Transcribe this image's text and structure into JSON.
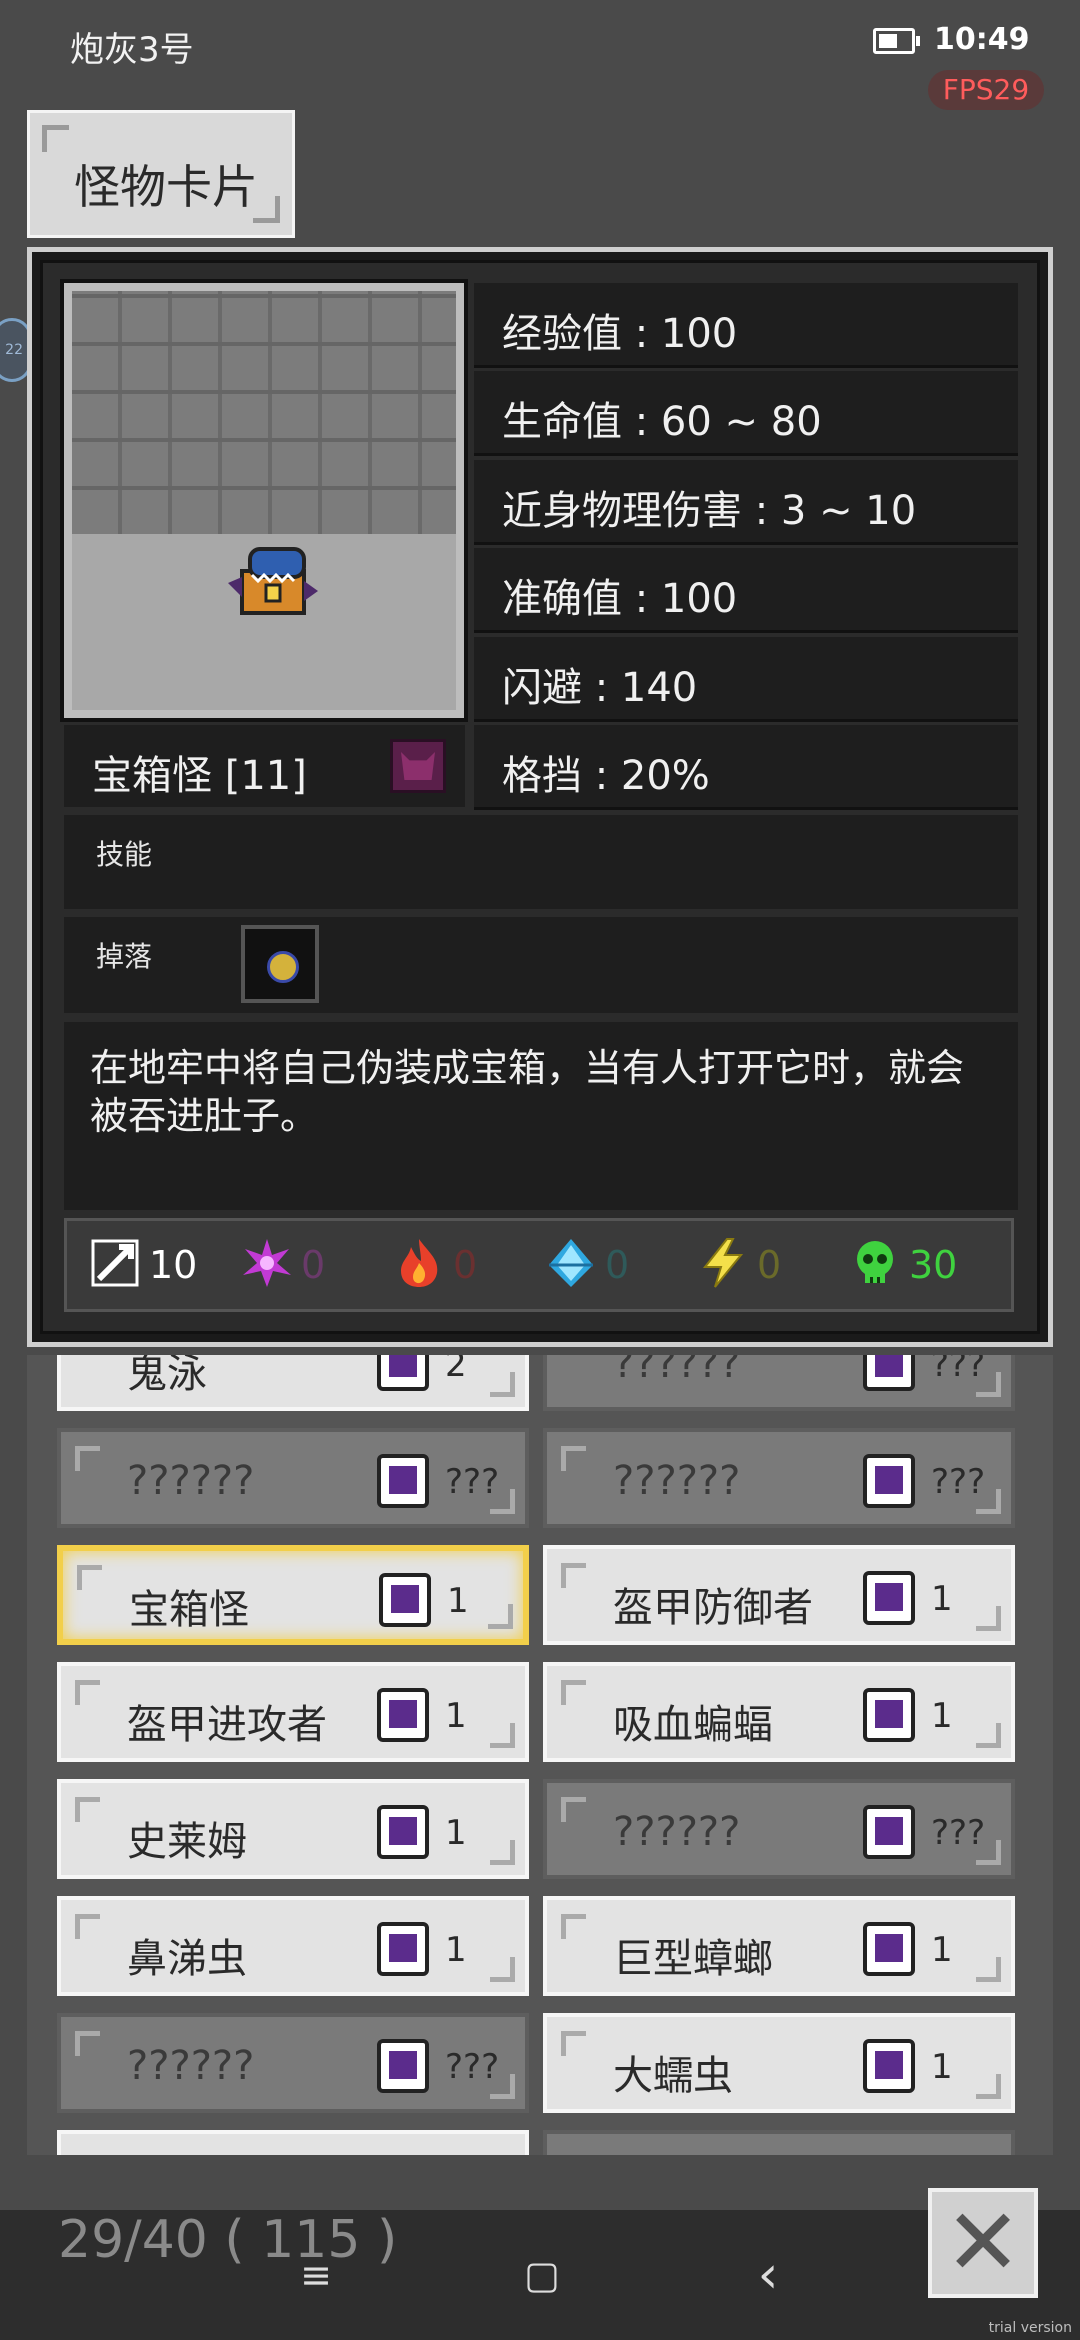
{
  "status_bar": {
    "title": "炮灰3号",
    "time": "10:49",
    "fps": "FPS29"
  },
  "tab": {
    "label": "怪物卡片"
  },
  "side_bubble": {
    "text": "22"
  },
  "monster": {
    "name": "宝箱怪 [11]",
    "stats": [
      "经验值 : 100",
      "生命值 : 60 ~ 80",
      "近身物理伤害 : 3 ~ 10",
      "准确值 : 100",
      "闪避 : 140",
      "格挡 : 20%"
    ],
    "skills_label": "技能",
    "drops_label": "掉落",
    "description": "在地牢中将自己伪装成宝箱，当有人打开它时，就会被吞进肚子。",
    "resistances": [
      {
        "icon": "sword-icon",
        "value": "10",
        "color": "#ffffff"
      },
      {
        "icon": "magic-burst-icon",
        "value": "0",
        "color": "#6a3a6a"
      },
      {
        "icon": "fire-icon",
        "value": "0",
        "color": "#6a3030"
      },
      {
        "icon": "ice-crystal-icon",
        "value": "0",
        "color": "#2f5a5a"
      },
      {
        "icon": "lightning-icon",
        "value": "0",
        "color": "#6a6a2a"
      },
      {
        "icon": "poison-skull-icon",
        "value": "30",
        "color": "#3fd23f"
      }
    ]
  },
  "list": {
    "items": [
      {
        "label": "鬼泳",
        "count": "2",
        "state": "known"
      },
      {
        "label": "??????",
        "count": "???",
        "state": "unknown"
      },
      {
        "label": "??????",
        "count": "???",
        "state": "unknown"
      },
      {
        "label": "??????",
        "count": "???",
        "state": "unknown"
      },
      {
        "label": "宝箱怪",
        "count": "1",
        "state": "selected"
      },
      {
        "label": "盔甲防御者",
        "count": "1",
        "state": "known"
      },
      {
        "label": "盔甲进攻者",
        "count": "1",
        "state": "known"
      },
      {
        "label": "吸血蝙蝠",
        "count": "1",
        "state": "known"
      },
      {
        "label": "史莱姆",
        "count": "1",
        "state": "known"
      },
      {
        "label": "??????",
        "count": "???",
        "state": "unknown"
      },
      {
        "label": "鼻涕虫",
        "count": "1",
        "state": "known"
      },
      {
        "label": "巨型蟑螂",
        "count": "1",
        "state": "known"
      },
      {
        "label": "??????",
        "count": "???",
        "state": "unknown"
      },
      {
        "label": "大蠕虫",
        "count": "1",
        "state": "known"
      }
    ]
  },
  "footer": {
    "page_count": "29/40 ( 115 )",
    "close": "✕",
    "watermark": "trial version"
  },
  "nav": {
    "menu": "≡",
    "home": "▢",
    "back": "‹"
  }
}
